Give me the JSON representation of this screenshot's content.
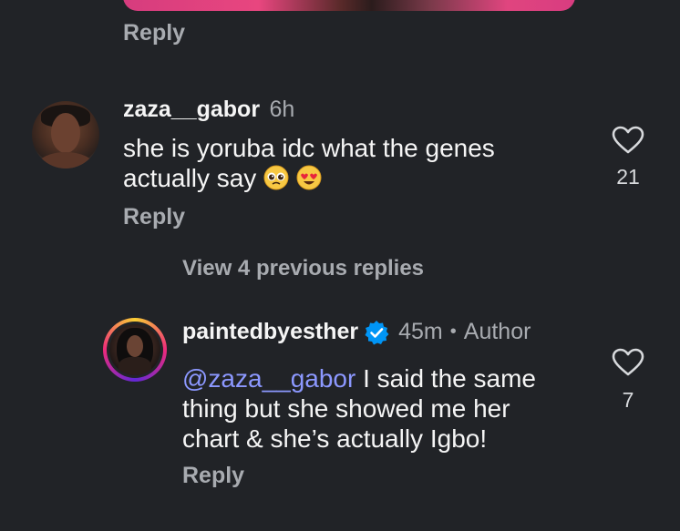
{
  "previous_comment": {
    "reply_label": "Reply"
  },
  "comment1": {
    "username": "zaza__gabor",
    "time": "6h",
    "text_line1": "she is yoruba idc what the genes",
    "text_line2": "actually say",
    "emojis": [
      "pleading-face-emoji",
      "heart-eyes-emoji"
    ],
    "likes": "21",
    "reply_label": "Reply",
    "view_replies_label": "View 4 previous replies"
  },
  "reply1": {
    "username": "paintedbyesther",
    "verified": true,
    "time": "45m",
    "separator": "•",
    "badge": "Author",
    "mention": "@zaza__gabor",
    "text_line1_rest": " I said the same",
    "text_line2": "thing but she showed me her",
    "text_line3": "chart & she’s actually Igbo!",
    "likes": "7",
    "reply_label": "Reply"
  },
  "colors": {
    "background": "#212327",
    "text": "#f5f5f5",
    "muted": "#a8abb0",
    "mention": "#8c98ff",
    "verified": "#0095f6"
  }
}
